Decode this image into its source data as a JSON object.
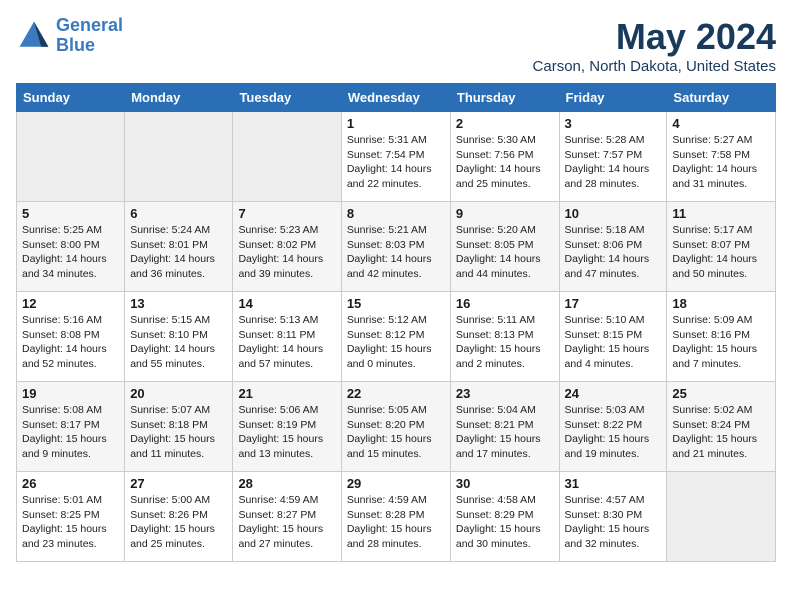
{
  "header": {
    "logo_line1": "General",
    "logo_line2": "Blue",
    "month_title": "May 2024",
    "location": "Carson, North Dakota, United States"
  },
  "days_of_week": [
    "Sunday",
    "Monday",
    "Tuesday",
    "Wednesday",
    "Thursday",
    "Friday",
    "Saturday"
  ],
  "weeks": [
    [
      {
        "day": "",
        "info": ""
      },
      {
        "day": "",
        "info": ""
      },
      {
        "day": "",
        "info": ""
      },
      {
        "day": "1",
        "info": "Sunrise: 5:31 AM\nSunset: 7:54 PM\nDaylight: 14 hours\nand 22 minutes."
      },
      {
        "day": "2",
        "info": "Sunrise: 5:30 AM\nSunset: 7:56 PM\nDaylight: 14 hours\nand 25 minutes."
      },
      {
        "day": "3",
        "info": "Sunrise: 5:28 AM\nSunset: 7:57 PM\nDaylight: 14 hours\nand 28 minutes."
      },
      {
        "day": "4",
        "info": "Sunrise: 5:27 AM\nSunset: 7:58 PM\nDaylight: 14 hours\nand 31 minutes."
      }
    ],
    [
      {
        "day": "5",
        "info": "Sunrise: 5:25 AM\nSunset: 8:00 PM\nDaylight: 14 hours\nand 34 minutes."
      },
      {
        "day": "6",
        "info": "Sunrise: 5:24 AM\nSunset: 8:01 PM\nDaylight: 14 hours\nand 36 minutes."
      },
      {
        "day": "7",
        "info": "Sunrise: 5:23 AM\nSunset: 8:02 PM\nDaylight: 14 hours\nand 39 minutes."
      },
      {
        "day": "8",
        "info": "Sunrise: 5:21 AM\nSunset: 8:03 PM\nDaylight: 14 hours\nand 42 minutes."
      },
      {
        "day": "9",
        "info": "Sunrise: 5:20 AM\nSunset: 8:05 PM\nDaylight: 14 hours\nand 44 minutes."
      },
      {
        "day": "10",
        "info": "Sunrise: 5:18 AM\nSunset: 8:06 PM\nDaylight: 14 hours\nand 47 minutes."
      },
      {
        "day": "11",
        "info": "Sunrise: 5:17 AM\nSunset: 8:07 PM\nDaylight: 14 hours\nand 50 minutes."
      }
    ],
    [
      {
        "day": "12",
        "info": "Sunrise: 5:16 AM\nSunset: 8:08 PM\nDaylight: 14 hours\nand 52 minutes."
      },
      {
        "day": "13",
        "info": "Sunrise: 5:15 AM\nSunset: 8:10 PM\nDaylight: 14 hours\nand 55 minutes."
      },
      {
        "day": "14",
        "info": "Sunrise: 5:13 AM\nSunset: 8:11 PM\nDaylight: 14 hours\nand 57 minutes."
      },
      {
        "day": "15",
        "info": "Sunrise: 5:12 AM\nSunset: 8:12 PM\nDaylight: 15 hours\nand 0 minutes."
      },
      {
        "day": "16",
        "info": "Sunrise: 5:11 AM\nSunset: 8:13 PM\nDaylight: 15 hours\nand 2 minutes."
      },
      {
        "day": "17",
        "info": "Sunrise: 5:10 AM\nSunset: 8:15 PM\nDaylight: 15 hours\nand 4 minutes."
      },
      {
        "day": "18",
        "info": "Sunrise: 5:09 AM\nSunset: 8:16 PM\nDaylight: 15 hours\nand 7 minutes."
      }
    ],
    [
      {
        "day": "19",
        "info": "Sunrise: 5:08 AM\nSunset: 8:17 PM\nDaylight: 15 hours\nand 9 minutes."
      },
      {
        "day": "20",
        "info": "Sunrise: 5:07 AM\nSunset: 8:18 PM\nDaylight: 15 hours\nand 11 minutes."
      },
      {
        "day": "21",
        "info": "Sunrise: 5:06 AM\nSunset: 8:19 PM\nDaylight: 15 hours\nand 13 minutes."
      },
      {
        "day": "22",
        "info": "Sunrise: 5:05 AM\nSunset: 8:20 PM\nDaylight: 15 hours\nand 15 minutes."
      },
      {
        "day": "23",
        "info": "Sunrise: 5:04 AM\nSunset: 8:21 PM\nDaylight: 15 hours\nand 17 minutes."
      },
      {
        "day": "24",
        "info": "Sunrise: 5:03 AM\nSunset: 8:22 PM\nDaylight: 15 hours\nand 19 minutes."
      },
      {
        "day": "25",
        "info": "Sunrise: 5:02 AM\nSunset: 8:24 PM\nDaylight: 15 hours\nand 21 minutes."
      }
    ],
    [
      {
        "day": "26",
        "info": "Sunrise: 5:01 AM\nSunset: 8:25 PM\nDaylight: 15 hours\nand 23 minutes."
      },
      {
        "day": "27",
        "info": "Sunrise: 5:00 AM\nSunset: 8:26 PM\nDaylight: 15 hours\nand 25 minutes."
      },
      {
        "day": "28",
        "info": "Sunrise: 4:59 AM\nSunset: 8:27 PM\nDaylight: 15 hours\nand 27 minutes."
      },
      {
        "day": "29",
        "info": "Sunrise: 4:59 AM\nSunset: 8:28 PM\nDaylight: 15 hours\nand 28 minutes."
      },
      {
        "day": "30",
        "info": "Sunrise: 4:58 AM\nSunset: 8:29 PM\nDaylight: 15 hours\nand 30 minutes."
      },
      {
        "day": "31",
        "info": "Sunrise: 4:57 AM\nSunset: 8:30 PM\nDaylight: 15 hours\nand 32 minutes."
      },
      {
        "day": "",
        "info": ""
      }
    ]
  ]
}
